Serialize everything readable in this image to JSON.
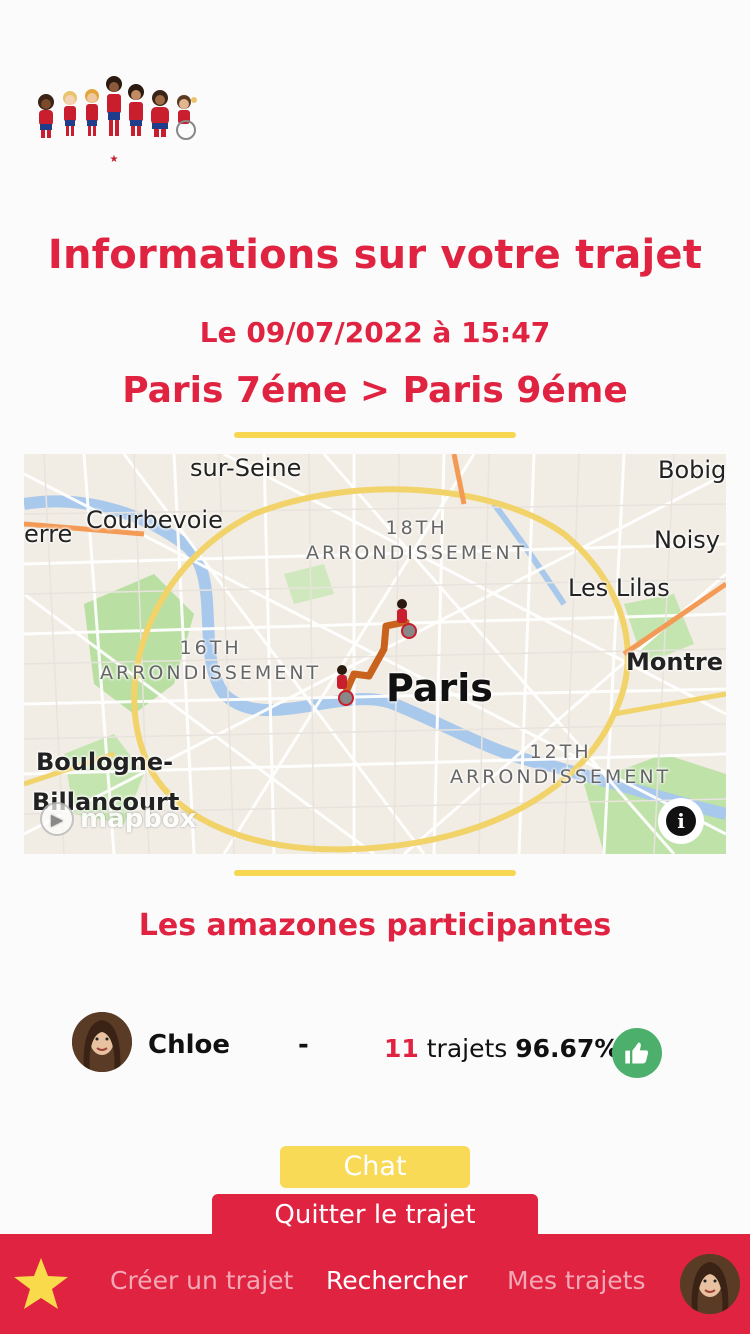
{
  "page": {
    "title": "Informations sur votre trajet",
    "date": "Le 09/07/2022 à 15:47",
    "route": "Paris 7éme > Paris 9éme"
  },
  "map": {
    "labels": {
      "sur_seine": "sur-Seine",
      "bobigny": "Bobig",
      "courbevoie": "Courbevoie",
      "erre": "erre",
      "arr18_num": "18TH",
      "arr18_word": "ARRONDISSEMENT",
      "noisy": "Noisy",
      "les_lilas": "Les Lilas",
      "arr16_num": "16TH",
      "arr16_word": "ARRONDISSEMENT",
      "paris": "Paris",
      "montreuil": "Montre",
      "boulogne": "Boulogne-",
      "billancourt": "Billancourt",
      "arr12_num": "12TH",
      "arr12_word": "ARRONDISSEMENT"
    },
    "attribution": "mapbox",
    "info_icon": "info-icon"
  },
  "participants": {
    "heading": "Les amazones participantes",
    "list": [
      {
        "name": "Chloe",
        "separator": "-",
        "trips_count": "11",
        "trips_label": "trajets",
        "rating": "96.67%",
        "rating_icon": "thumbs-up-icon"
      }
    ]
  },
  "actions": {
    "chat_label": "Chat",
    "quit_label": "Quitter le trajet"
  },
  "nav": {
    "home_icon": "star-icon",
    "items": [
      {
        "label": "Créer un trajet",
        "active": false
      },
      {
        "label": "Rechercher",
        "active": true
      },
      {
        "label": "Mes trajets",
        "active": false
      }
    ]
  },
  "colors": {
    "brand_red": "#df2341",
    "accent_yellow": "#f7d652",
    "rating_green": "#4caf6b",
    "route_orange": "#c8621c"
  }
}
